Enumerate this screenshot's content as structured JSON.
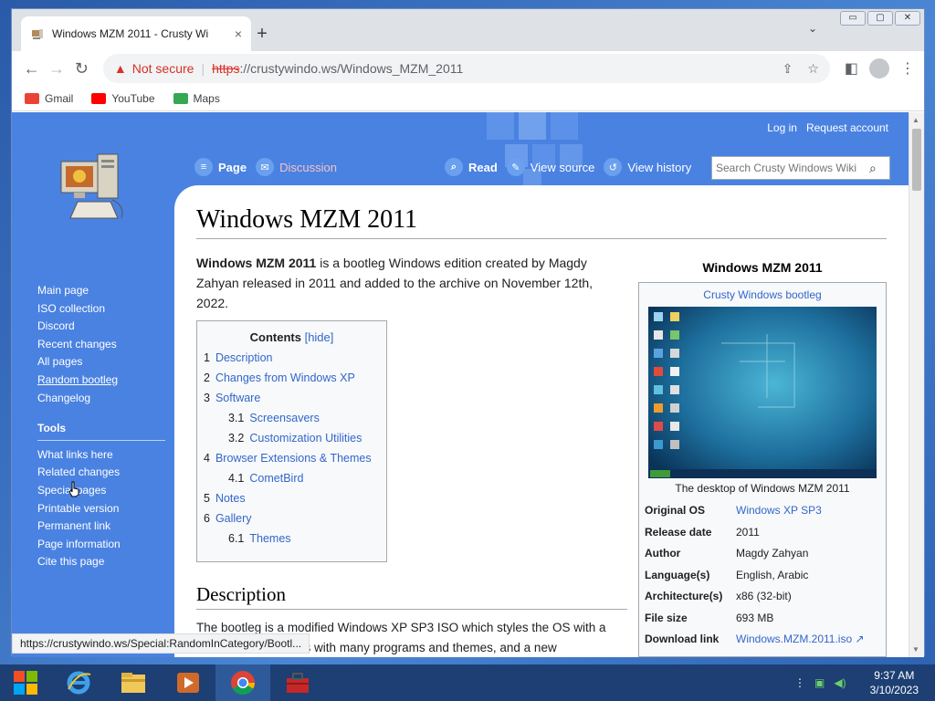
{
  "browser": {
    "tab_title": "Windows MZM 2011 - Crusty Wi",
    "tab_close": "×",
    "new_tab": "+",
    "tab_menu": "⌄",
    "window_controls": [
      "▭",
      "▢",
      "✕"
    ],
    "security_label": "Not secure",
    "url_scheme": "https",
    "url_rest": "://crustywindo.ws/Windows_MZM_2011",
    "bookmarks": [
      {
        "label": "Gmail",
        "color": "#ea4335"
      },
      {
        "label": "YouTube",
        "color": "#ff0000"
      },
      {
        "label": "Maps",
        "color": "#34a853"
      }
    ],
    "status_url": "https://crustywindo.ws/Special:RandomInCategory/Bootl..."
  },
  "wiki": {
    "top_links": [
      "Log in",
      "Request account"
    ],
    "left_tabs": [
      "Page",
      "Discussion"
    ],
    "right_tabs": [
      "Read",
      "View source",
      "View history"
    ],
    "search_placeholder": "Search Crusty Windows Wiki",
    "sidebar_nav": [
      "Main page",
      "ISO collection",
      "Discord",
      "Recent changes",
      "All pages",
      "Random bootleg",
      "Changelog"
    ],
    "tools_header": "Tools",
    "tools": [
      "What links here",
      "Related changes",
      "Special pages",
      "Printable version",
      "Permanent link",
      "Page information",
      "Cite this page"
    ]
  },
  "article": {
    "title": "Windows MZM 2011",
    "intro_bold": "Windows MZM 2011",
    "intro_text": " is a bootleg Windows edition created by Magdy Zahyan released in 2011 and added to the archive on November 12th, 2022.",
    "toc_title": "Contents",
    "toc_hide": "[hide]",
    "toc": [
      {
        "num": "1",
        "label": "Description",
        "sub": false
      },
      {
        "num": "2",
        "label": "Changes from Windows XP",
        "sub": false
      },
      {
        "num": "3",
        "label": "Software",
        "sub": false
      },
      {
        "num": "3.1",
        "label": "Screensavers",
        "sub": true
      },
      {
        "num": "3.2",
        "label": "Customization Utilities",
        "sub": true
      },
      {
        "num": "4",
        "label": "Browser Extensions & Themes",
        "sub": false
      },
      {
        "num": "4.1",
        "label": "CometBird",
        "sub": true
      },
      {
        "num": "5",
        "label": "Notes",
        "sub": false
      },
      {
        "num": "6",
        "label": "Gallery",
        "sub": false
      },
      {
        "num": "6.1",
        "label": "Themes",
        "sub": true
      }
    ],
    "section_heading": "Description",
    "section_text": "The bootleg is a modified Windows XP SP3 ISO which styles the OS with a blue theme. It comes with many programs and themes, and a new"
  },
  "infobox": {
    "title": "Windows MZM 2011",
    "subtitle_link": "Crusty Windows",
    "subtitle_rest": " bootleg",
    "caption": "The desktop of Windows MZM 2011",
    "rows": [
      {
        "k": "Original OS",
        "v": "Windows XP SP3",
        "link": true
      },
      {
        "k": "Release date",
        "v": "2011",
        "link": false
      },
      {
        "k": "Author",
        "v": "Magdy Zahyan",
        "link": false
      },
      {
        "k": "Language(s)",
        "v": "English, Arabic",
        "link": false
      },
      {
        "k": "Architecture(s)",
        "v": "x86 (32-bit)",
        "link": false
      },
      {
        "k": "File size",
        "v": "693 MB",
        "link": false
      },
      {
        "k": "Download link",
        "v": "Windows.MZM.2011.iso ↗",
        "link": true
      }
    ]
  },
  "taskbar": {
    "time": "9:37 AM",
    "date": "3/10/2023"
  }
}
